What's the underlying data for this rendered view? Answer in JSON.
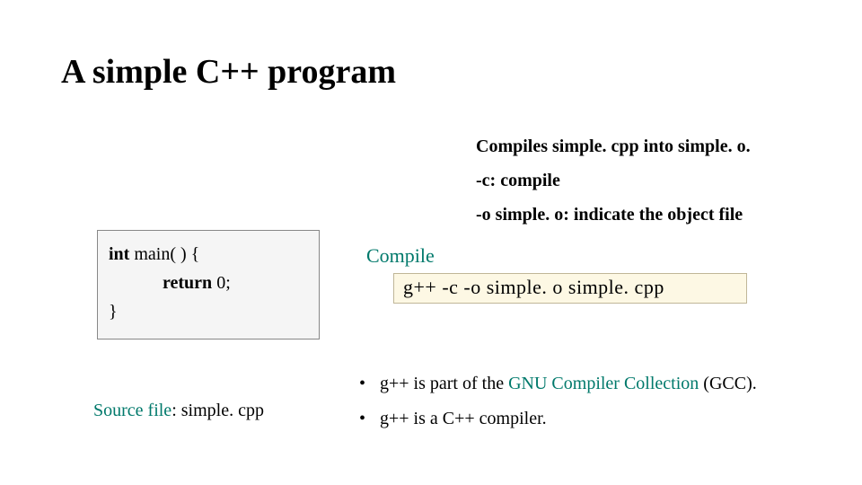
{
  "title": "A simple C++ program",
  "annotations": {
    "line1": "Compiles simple. cpp into simple. o.",
    "line2": "-c: compile",
    "line3": "-o simple. o: indicate the object file"
  },
  "code": {
    "line1a": "int",
    "line1b": " main( ) {",
    "line2a": "return",
    "line2b": " 0;",
    "line3": "}"
  },
  "compile_label": "Compile",
  "command": "g++  -c  -o  simple. o  simple. cpp",
  "source_label": {
    "prefix": "Source file",
    "rest": ": simple. cpp"
  },
  "bullets": {
    "b1a": "g++ is part of the ",
    "b1b": "GNU Compiler Collection",
    "b1c": " (GCC).",
    "b2": "g++ is a C++ compiler."
  }
}
